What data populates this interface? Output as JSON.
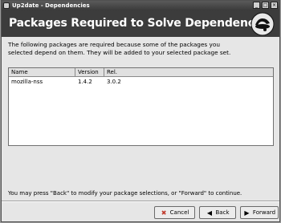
{
  "window": {
    "title": "Up2date - Dependencies",
    "controls": {
      "minimize": "_",
      "maximize": "□",
      "close": "×"
    }
  },
  "banner": {
    "title": "Packages Required to Solve Dependencies",
    "logo_icon": "redhat-shadowman-icon"
  },
  "description": {
    "line1": "The following packages are required because some of the packages you",
    "line2": "selected depend on them.  They will be added to your selected package set."
  },
  "table": {
    "columns": [
      "Name",
      "Version",
      "Rel."
    ],
    "rows": [
      {
        "name": "mozilla-nss",
        "version": "1.4.2",
        "rel": "3.0.2"
      }
    ]
  },
  "hint": "You may press \"Back\" to modify your package selections, or \"Forward\" to continue.",
  "buttons": {
    "cancel": "Cancel",
    "back": "Back",
    "forward": "Forward"
  },
  "colors": {
    "banner_bg": "#3c3c3c",
    "window_bg": "#e6e6e6",
    "cancel_icon": "#c0392b"
  }
}
